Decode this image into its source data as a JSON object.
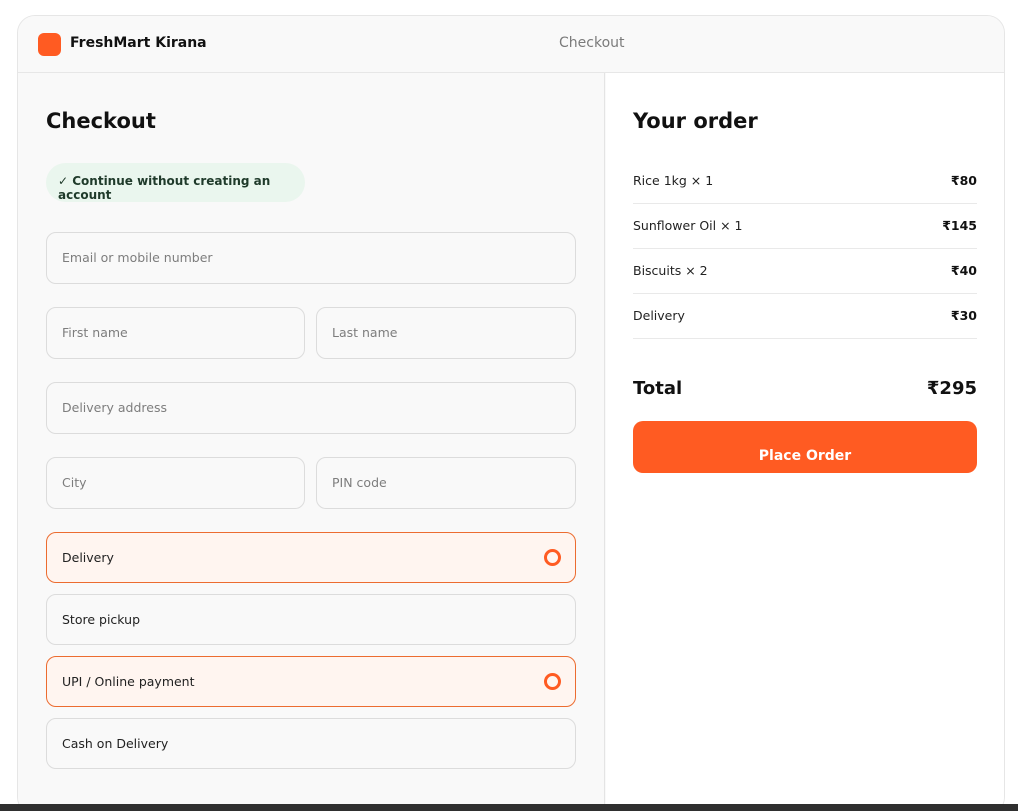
{
  "brand": {
    "name": "FreshMart Kirana",
    "accent": "#ff5b22"
  },
  "header": {
    "title": "Checkout"
  },
  "form": {
    "title": "Checkout",
    "guest_label": "✓ Continue without creating an account",
    "email_placeholder": "Email or mobile number",
    "first_name_placeholder": "First name",
    "last_name_placeholder": "Last name",
    "address_placeholder": "Delivery address",
    "city_placeholder": "City",
    "pin_placeholder": "PIN code",
    "fulfillment_options": [
      {
        "label": "Delivery",
        "selected": true
      },
      {
        "label": "Store pickup",
        "selected": false
      }
    ],
    "payment_options": [
      {
        "label": "UPI / Online payment",
        "selected": true
      },
      {
        "label": "Cash on Delivery",
        "selected": false
      }
    ]
  },
  "order": {
    "title": "Your order",
    "items": [
      {
        "label": "Rice 1kg × 1",
        "price": "₹80"
      },
      {
        "label": "Sunflower Oil × 1",
        "price": "₹145"
      },
      {
        "label": "Biscuits × 2",
        "price": "₹40"
      },
      {
        "label": "Delivery",
        "price": "₹30"
      }
    ],
    "total_label": "Total",
    "total_value": "₹295",
    "place_order_label": "Place Order"
  }
}
